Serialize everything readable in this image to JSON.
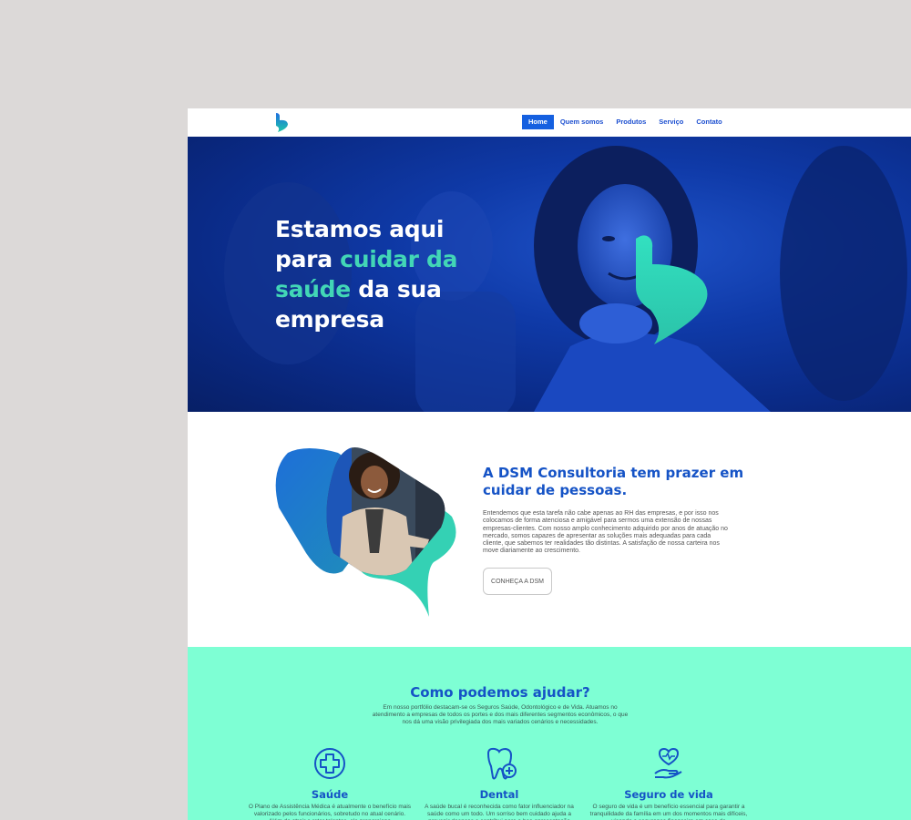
{
  "nav": {
    "logo_icon": "dsm-logo-icon",
    "items": [
      {
        "label": "Home",
        "active": true
      },
      {
        "label": "Quem somos"
      },
      {
        "label": "Produtos"
      },
      {
        "label": "Serviço"
      },
      {
        "label": "Contato"
      }
    ]
  },
  "hero": {
    "title_line1": "Estamos aqui",
    "title_line2_pre": "para ",
    "title_line2_accent": "cuidar da",
    "title_line3_accent": "saúde",
    "title_line3_post": " da sua",
    "title_line4": "empresa",
    "accent_color": "#42d6b6"
  },
  "about": {
    "title": "A DSM Consultoria tem prazer em cuidar de pessoas.",
    "text": "Entendemos que esta tarefa não cabe apenas ao RH das empresas, e por isso nos colocamos de forma atenciosa e amigável para sermos uma extensão de nossas empresas-clientes. Com nosso amplo conhecimento adquirido por anos de atuação no mercado, somos capazes de apresentar as soluções mais adequadas para cada cliente, que sabemos ter realidades tão distintas. A satisfação de nossa carteira nos move diariamente ao crescimento.",
    "button_label": "CONHEÇA A DSM"
  },
  "help": {
    "title": "Como podemos ajudar?",
    "intro": "Em nosso portfólio destacam-se os Seguros Saúde, Odontológico e de Vida. Atuamos no atendimento a empresas de todos os portes e dos mais diferentes segmentos econômicos, o que nos dá uma visão privilegiada dos mais variados cenários e necessidades.",
    "cards": [
      {
        "icon": "medical-cross-icon",
        "title": "Saúde",
        "text": "O Plano de Assistência Médica é atualmente o benefício mais valorizado pelos funcionários, sobretudo no atual cenário. Além de atrair e reter talentos, ele proporciona"
      },
      {
        "icon": "tooth-icon",
        "title": "Dental",
        "text": "A saúde bucal é reconhecida como fator influenciador na saúde como um todo. Um sorriso bem cuidado ajuda a prevenir doenças e contribui para a boa apresentação"
      },
      {
        "icon": "heart-hand-icon",
        "title": "Seguro de vida",
        "text": "O seguro de vida é um benefício essencial para garantir a tranquilidade da família em um dos momentos mais difíceis, visando a segurança financeira em caso de"
      }
    ]
  },
  "colors": {
    "brand_blue": "#1553c6",
    "nav_active": "#1560e0",
    "teal": "#42d6b6",
    "mint": "#7effd4"
  }
}
